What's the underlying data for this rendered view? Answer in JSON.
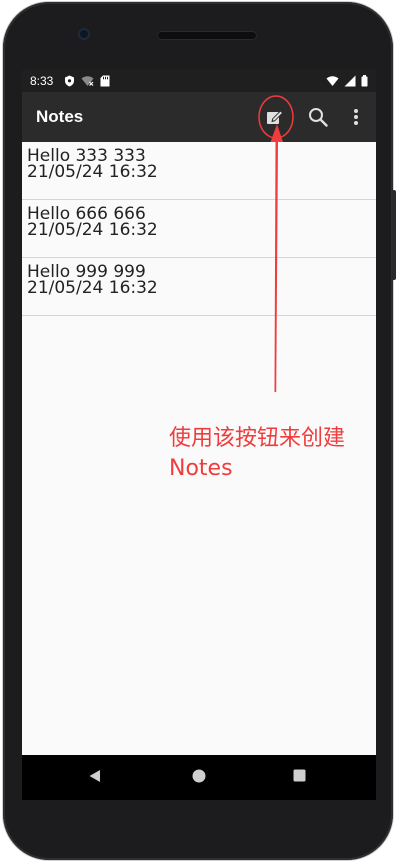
{
  "status_bar": {
    "time": "8:33",
    "left_icons": [
      "shield-icon",
      "wifi-off-icon",
      "sd-card-icon"
    ],
    "right_icons": [
      "wifi-icon",
      "signal-icon",
      "battery-icon"
    ]
  },
  "app_bar": {
    "title": "Notes",
    "actions": [
      "compose-icon",
      "search-icon",
      "overflow-menu-icon"
    ]
  },
  "notes": [
    {
      "title": "Hello 333 333",
      "date": "21/05/24 16:32"
    },
    {
      "title": "Hello 666 666",
      "date": "21/05/24 16:32"
    },
    {
      "title": "Hello 999 999",
      "date": "21/05/24 16:32"
    }
  ],
  "annotation": {
    "line1": "使用该按钮来创建",
    "line2": "Notes",
    "color": "#f03c3c"
  },
  "nav_bar": {
    "buttons": [
      "back-icon",
      "home-icon",
      "recents-icon"
    ]
  },
  "colors": {
    "app_bar": "#2b2b2b",
    "status_bar": "#1f1f1f",
    "background": "#fafafa",
    "annotation": "#f03c3c"
  }
}
